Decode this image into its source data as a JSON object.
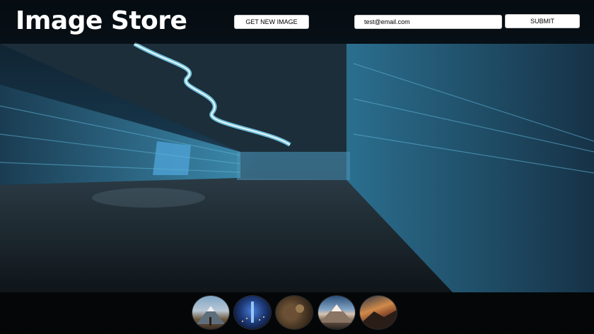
{
  "header": {
    "title": "Image Store",
    "get_new_image_label": "GET NEW IMAGE",
    "email_value": "test@email.com",
    "submit_label": "SUBMIT"
  },
  "thumbnails": [
    {
      "icon": "mountain-thumbnail"
    },
    {
      "icon": "city-lights-thumbnail"
    },
    {
      "icon": "aerial-thumbnail"
    },
    {
      "icon": "snowy-peak-thumbnail"
    },
    {
      "icon": "sunset-mountain-thumbnail"
    }
  ]
}
